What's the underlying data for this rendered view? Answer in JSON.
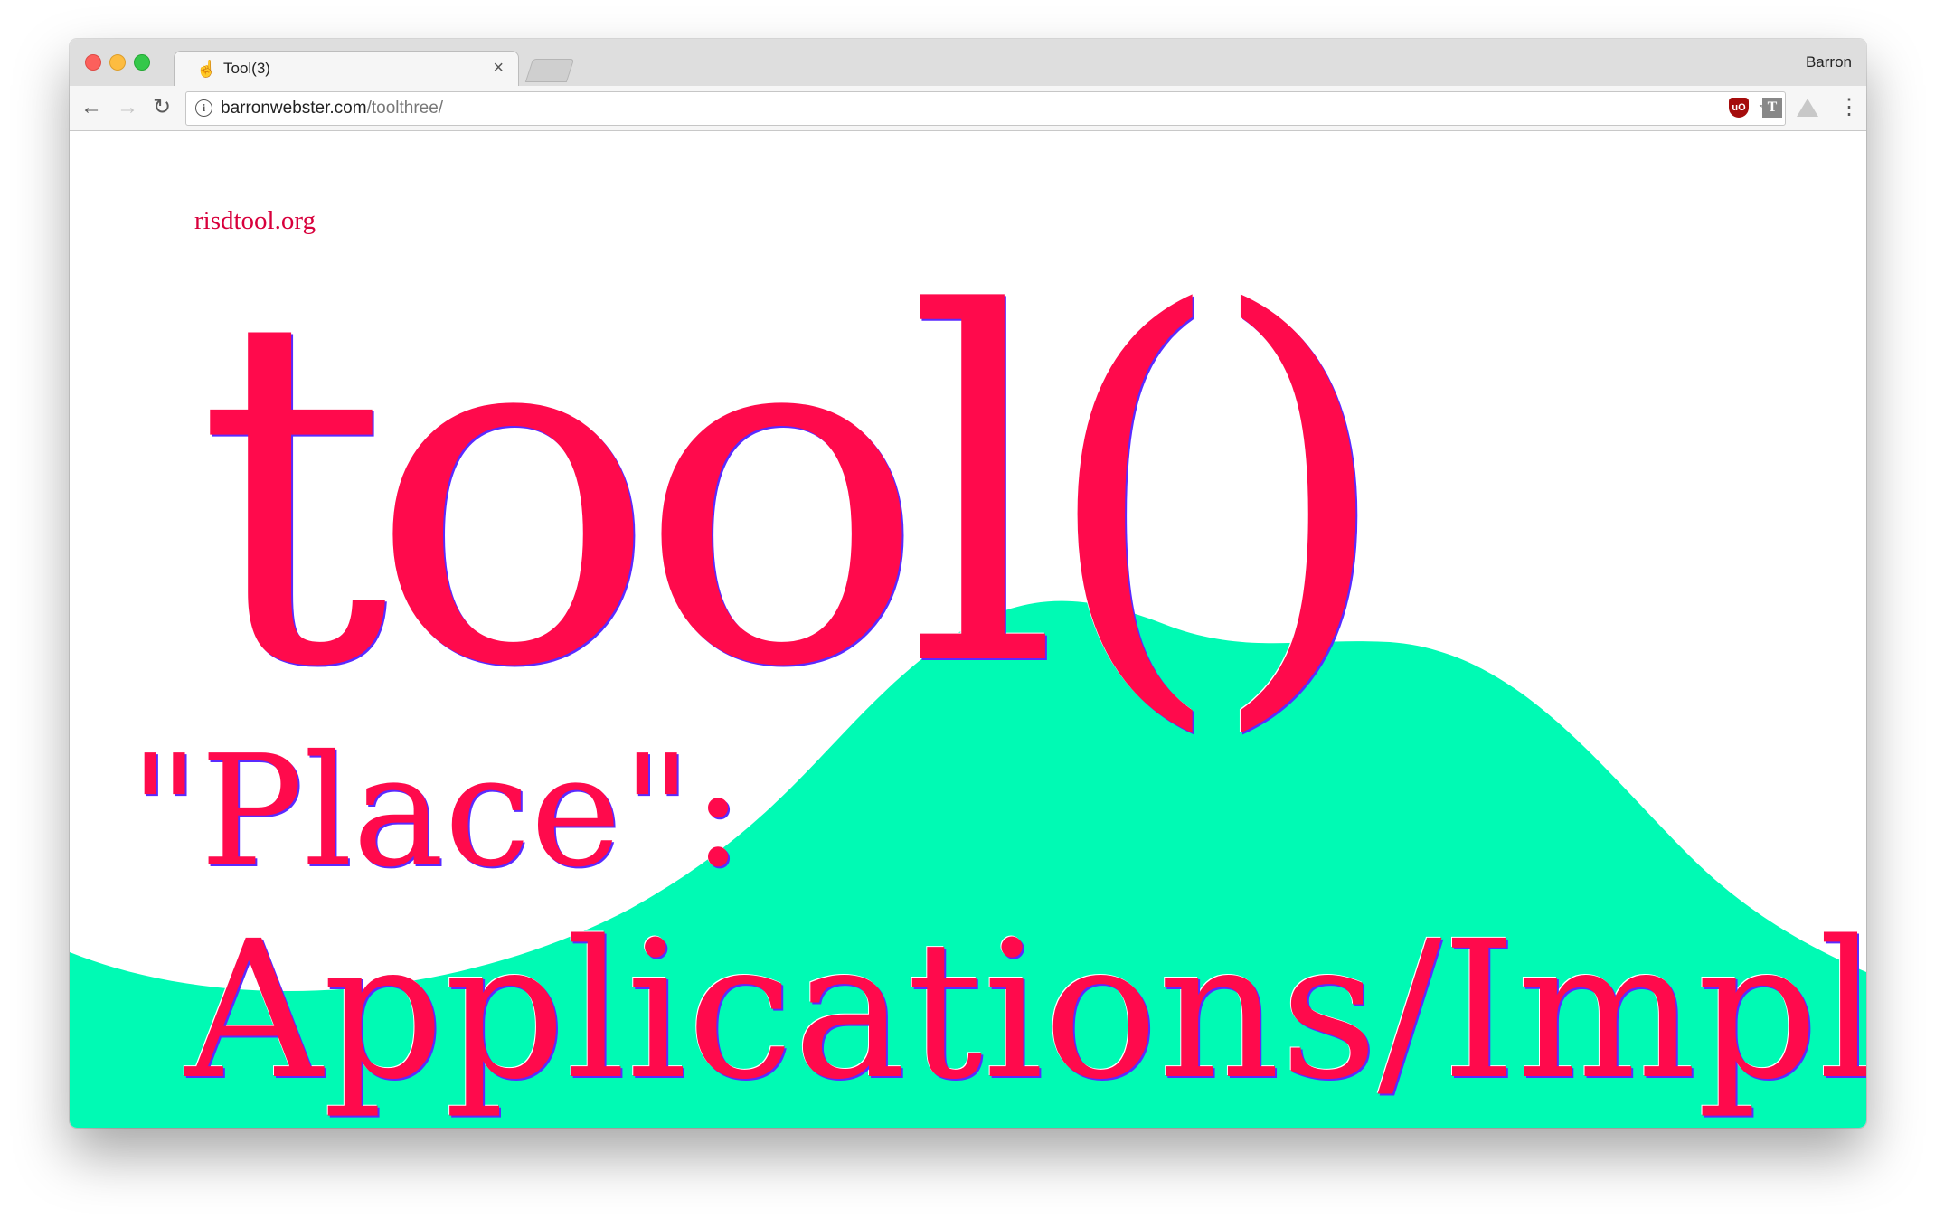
{
  "browser": {
    "tab": {
      "title": "Tool(3)",
      "close_glyph": "×",
      "icon": "pointer-hand-icon"
    },
    "profile_name": "Barron",
    "address": {
      "domain": "barronwebster.com",
      "path": "/toolthree/"
    },
    "nav": {
      "back_glyph": "←",
      "forward_glyph": "→",
      "reload_glyph": "↻",
      "star_glyph": "☆",
      "menu_glyph": "⋮",
      "info_glyph": "i"
    },
    "extensions": {
      "ublock_label": "uO",
      "typewolf_label": "T"
    }
  },
  "page": {
    "site_link": "risdtool.org",
    "title": "tool()",
    "subtitle_line1": "\"Place\":",
    "subtitle_line2": "Applications/Implica",
    "colors": {
      "accent": "#ff0a4c",
      "hill": "#00fab4",
      "shadow": "#5a2aff"
    }
  }
}
